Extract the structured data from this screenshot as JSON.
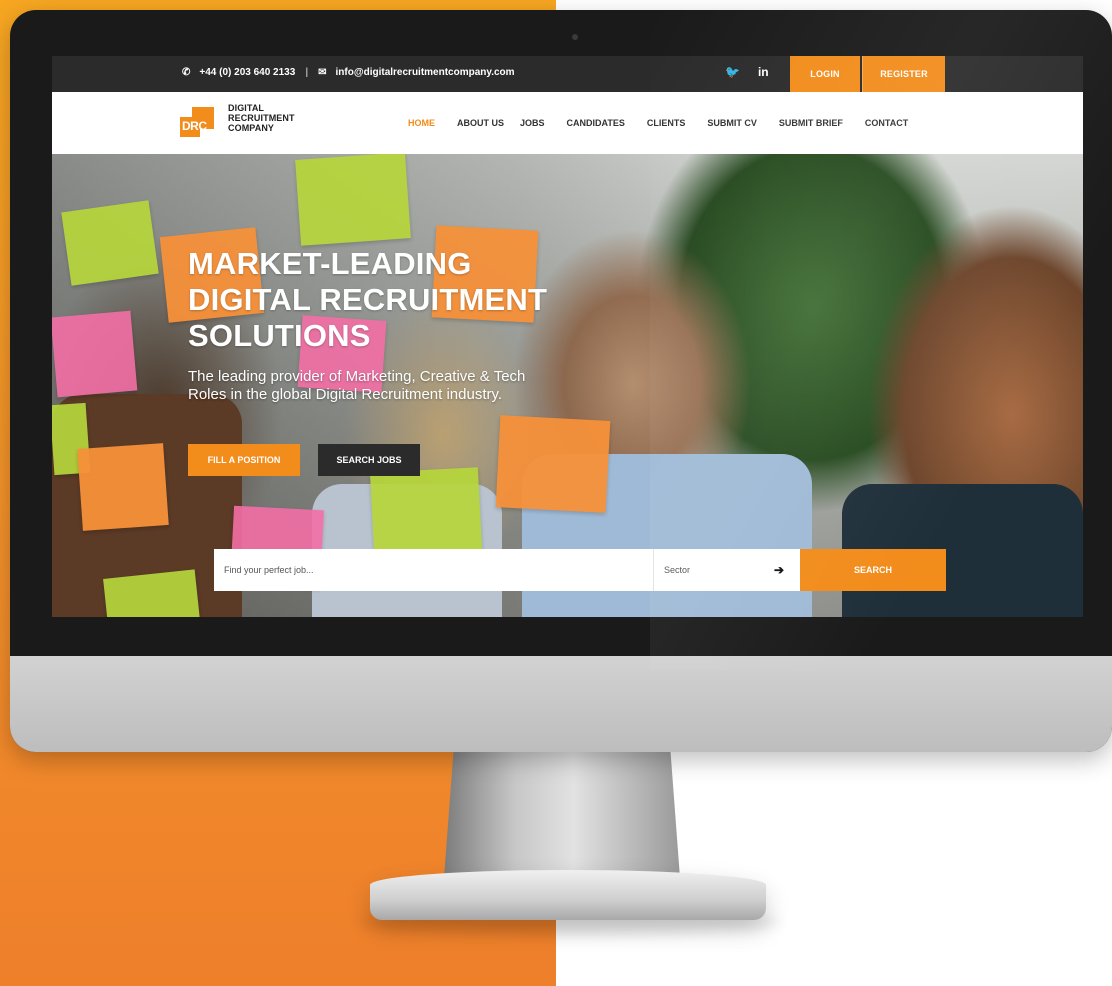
{
  "topbar": {
    "phone": "+44 (0) 203 640 2133",
    "separator": "|",
    "email": "info@digitalrecruitmentcompany.com",
    "social": [
      "twitter-icon",
      "linkedin-icon"
    ],
    "social_labels": [
      "🐦",
      "in"
    ],
    "login_label": "LOGIN",
    "register_label": "REGISTER"
  },
  "logo": {
    "mark_text": "DRC",
    "line1": "DIGITAL",
    "line2": "RECRUITMENT",
    "line3": "COMPANY"
  },
  "nav": {
    "items": [
      {
        "label": "HOME",
        "active": true
      },
      {
        "label": "ABOUT US",
        "active": false
      },
      {
        "label": "JOBS",
        "active": false
      },
      {
        "label": "CANDIDATES",
        "active": false
      },
      {
        "label": "CLIENTS",
        "active": false
      },
      {
        "label": "SUBMIT CV",
        "active": false
      },
      {
        "label": "SUBMIT BRIEF",
        "active": false
      },
      {
        "label": "CONTACT",
        "active": false
      }
    ]
  },
  "hero": {
    "title_line1": "MARKET-LEADING",
    "title_line2": "DIGITAL RECRUITMENT",
    "title_line3": "SOLUTIONS",
    "subtitle_line1": "The leading provider of Marketing, Creative & Tech",
    "subtitle_line2": "Roles in the global Digital Recruitment industry.",
    "fill_position_label": "FILL A POSITION",
    "search_jobs_label": "SEARCH JOBS"
  },
  "search": {
    "placeholder": "Find your perfect job...",
    "sector_label": "Sector",
    "arrow": "➔",
    "button_label": "SEARCH"
  },
  "colors": {
    "accent": "#f28c1b",
    "dark": "#2b2b2b"
  }
}
